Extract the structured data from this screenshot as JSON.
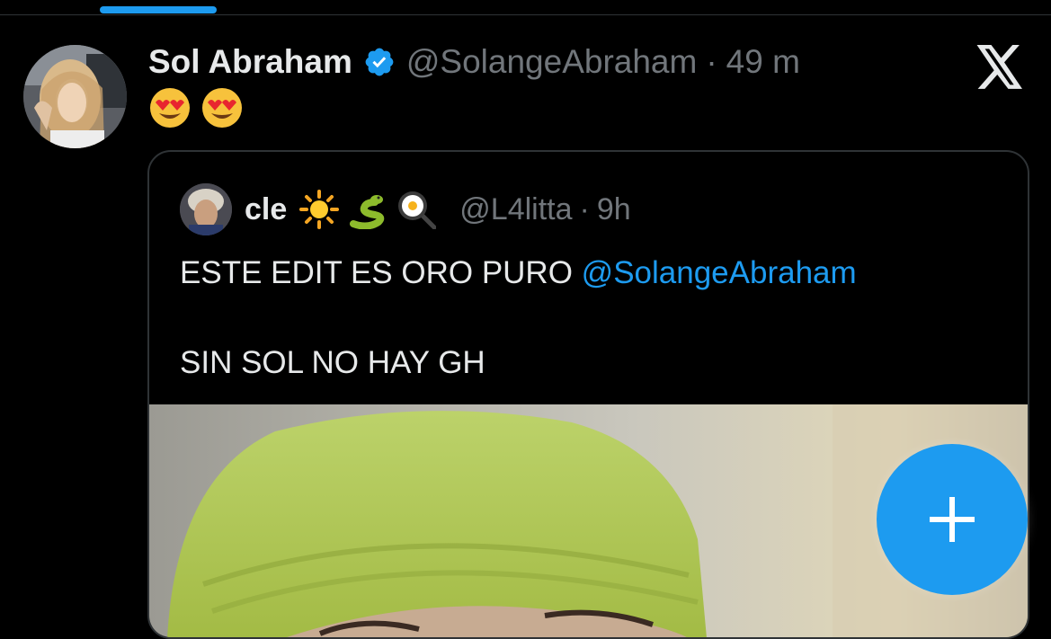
{
  "tweet": {
    "display_name": "Sol Abraham",
    "handle": "@SolangeAbraham",
    "separator": "·",
    "time": "49 m",
    "text_emojis": [
      "smiling-face-with-heart-eyes",
      "smiling-face-with-heart-eyes"
    ]
  },
  "quoted_tweet": {
    "display_name": "cle",
    "name_emojis": [
      "sun",
      "snake",
      "fried-egg-in-pan"
    ],
    "handle": "@L4litta",
    "separator": "·",
    "time": "9h",
    "text_line1": "ESTE EDIT ES ORO PURO ",
    "mention": "@SolangeAbraham",
    "text_line2": "SIN SOL NO HAY GH"
  },
  "icons": {
    "verified": "verified-badge-icon",
    "logo": "x-logo-icon",
    "compose": "plus-icon"
  },
  "colors": {
    "background": "#000000",
    "accent": "#1d9bf0",
    "primary_text": "#e7e9ea",
    "secondary_text": "#71767b",
    "border": "#2f3336"
  }
}
